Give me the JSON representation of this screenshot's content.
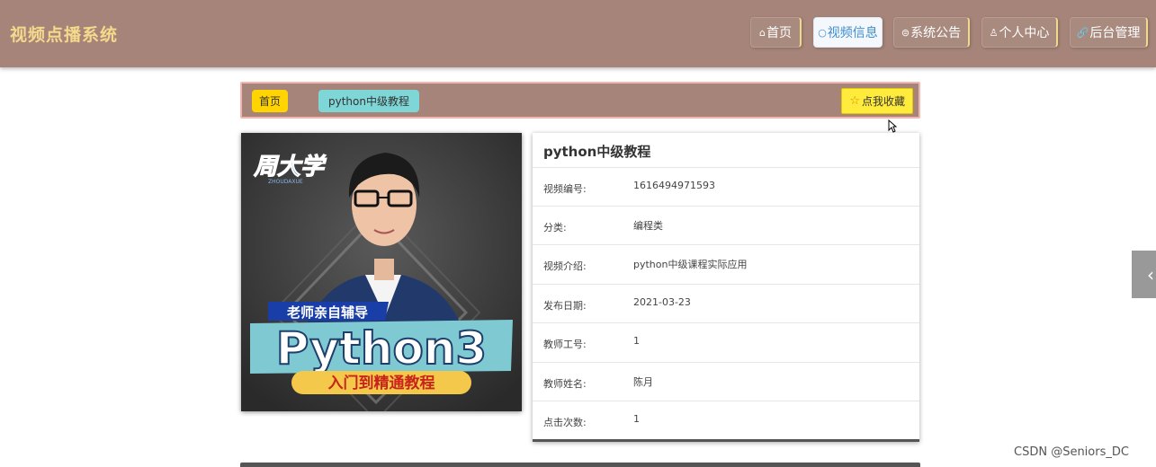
{
  "header": {
    "brand": "视频点播系统",
    "nav": [
      {
        "icon": "⌂",
        "label": "首页"
      },
      {
        "icon": "○",
        "label": "视频信息"
      },
      {
        "icon": "⊜",
        "label": "系统公告"
      },
      {
        "icon": "♙",
        "label": "个人中心"
      },
      {
        "icon": "🔗",
        "label": "后台管理"
      }
    ]
  },
  "breadcrumb": {
    "home": "首页",
    "current": "python中级教程",
    "favorite_icon": "☆",
    "favorite_label": "点我收藏"
  },
  "thumbnail": {
    "logo_text": "周大学",
    "logo_sub": "ZHOUDAXUE",
    "tag": "老师亲自辅导",
    "big": "Python3",
    "sub": "入门到精通教程"
  },
  "info": {
    "title": "python中级教程",
    "rows": [
      {
        "key": "视频编号:",
        "value": "1616494971593"
      },
      {
        "key": "分类:",
        "value": "编程类"
      },
      {
        "key": "视频介绍:",
        "value": "python中级课程实际应用"
      },
      {
        "key": "发布日期:",
        "value": "2021-03-23"
      },
      {
        "key": "教师工号:",
        "value": "1"
      },
      {
        "key": "教师姓名:",
        "value": "陈月"
      },
      {
        "key": "点击次数:",
        "value": "1"
      }
    ]
  },
  "side_tab_icon": "‹",
  "watermark": "CSDN @Seniors_DC",
  "colors": {
    "header": "#a68479",
    "brand": "#f3d98c",
    "active_nav": "#3f8ecf",
    "home_crumb": "#ffd400",
    "current_crumb": "#7fd6d6",
    "fav_button": "#ffeb3b"
  }
}
